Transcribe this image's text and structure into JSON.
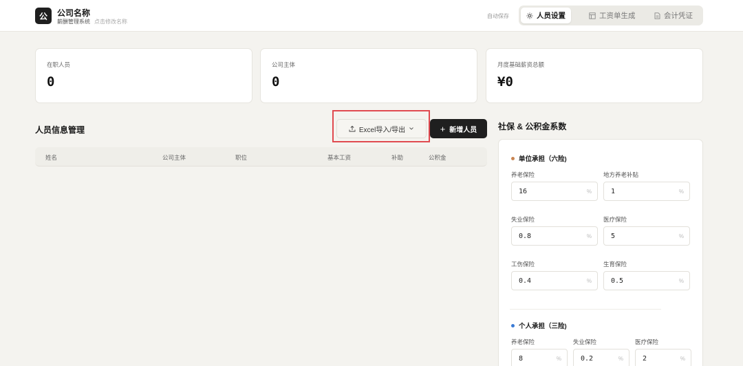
{
  "header": {
    "logo_char": "公",
    "company_name": "公司名称",
    "company_sub": "薪酬管理系统",
    "company_hint": "点击修改名称",
    "autosave": "自动保存",
    "tabs": [
      {
        "label": "人员设置",
        "icon": "sun-gear-icon",
        "active": true
      },
      {
        "label": "工资单生成",
        "icon": "table-icon",
        "active": false
      },
      {
        "label": "会计凭证",
        "icon": "document-icon",
        "active": false
      }
    ]
  },
  "stats": [
    {
      "label": "在职人员",
      "value": "0"
    },
    {
      "label": "公司主体",
      "value": "0"
    },
    {
      "label": "月度基础薪资总额",
      "value": "¥0"
    }
  ],
  "staff": {
    "title": "人员信息管理",
    "excel_button": "Excel导入/导出",
    "add_button": "新增人员",
    "columns": [
      "姓名",
      "公司主体",
      "职位",
      "基本工资",
      "补助",
      "公积金"
    ]
  },
  "insurance": {
    "title": "社保 & 公积金系数",
    "company_group": {
      "title": "单位承担（六险)",
      "color": "#c98552",
      "fields": [
        {
          "label": "养老保险",
          "value": "16",
          "unit": "%"
        },
        {
          "label": "地方养老补贴",
          "value": "1",
          "unit": "%"
        },
        {
          "label": "失业保险",
          "value": "0.8",
          "unit": "%"
        },
        {
          "label": "医疗保险",
          "value": "5",
          "unit": "%"
        },
        {
          "label": "工伤保险",
          "value": "0.4",
          "unit": "%"
        },
        {
          "label": "生育保险",
          "value": "0.5",
          "unit": "%"
        }
      ]
    },
    "personal_group": {
      "title": "个人承担（三险)",
      "color": "#3a7bd5",
      "fields": [
        {
          "label": "养老保险",
          "value": "8",
          "unit": "%"
        },
        {
          "label": "失业保险",
          "value": "0.2",
          "unit": "%"
        },
        {
          "label": "医疗保险",
          "value": "2",
          "unit": "%"
        }
      ]
    }
  }
}
